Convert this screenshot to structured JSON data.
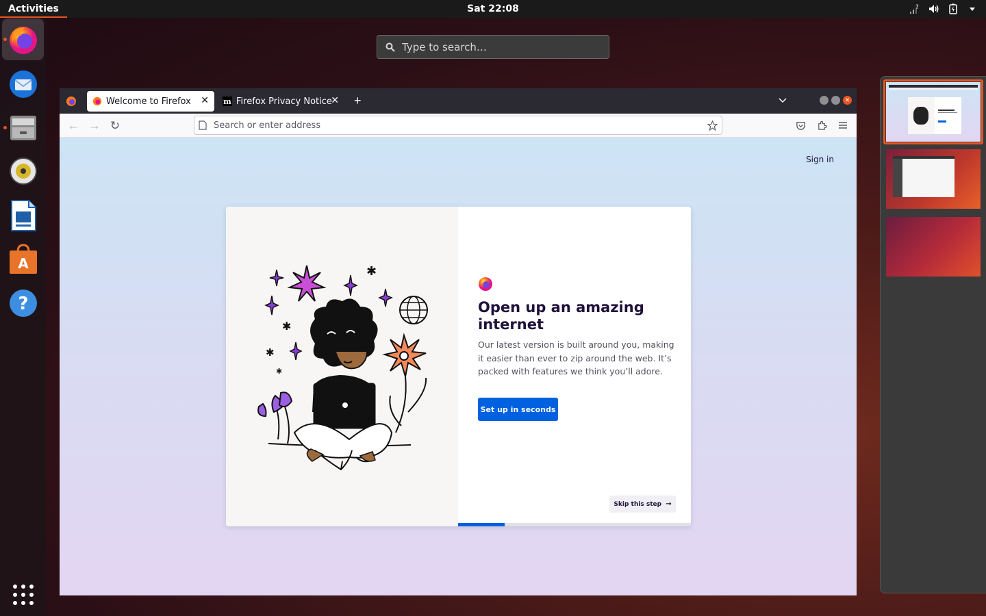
{
  "topbar": {
    "activities": "Activities",
    "clock": "Sat 22:08"
  },
  "search": {
    "placeholder": "Type to search…"
  },
  "dock": {
    "apps": [
      {
        "name": "Firefox",
        "icon": "firefox-icon",
        "running": true,
        "active": true
      },
      {
        "name": "Thunderbird",
        "icon": "thunderbird-icon",
        "running": false
      },
      {
        "name": "Files",
        "icon": "files-icon",
        "running": true
      },
      {
        "name": "Rhythmbox",
        "icon": "rhythmbox-icon",
        "running": false
      },
      {
        "name": "LibreOffice Writer",
        "icon": "writer-icon",
        "running": false
      },
      {
        "name": "Ubuntu Software",
        "icon": "software-icon",
        "running": false
      },
      {
        "name": "Help",
        "icon": "help-icon",
        "running": false
      }
    ],
    "show_apps_icon": "grid-icon"
  },
  "browser": {
    "tabs": [
      {
        "label": "Welcome to Firefox",
        "active": true
      },
      {
        "label": "Firefox Privacy Notice —",
        "active": false
      }
    ],
    "url_placeholder": "Search or enter address",
    "page": {
      "sign_in": "Sign in",
      "headline": "Open up an amazing internet",
      "body": "Our latest version is built around you, making it easier than ever to zip around the web. It’s packed with features we think you’ll adore.",
      "primary_button": "Set up in seconds",
      "skip_button": "Skip this step",
      "progress": 0.2
    }
  },
  "colors": {
    "accent": "#e95420",
    "firefox_blue": "#0061e0",
    "tabbar": "#2b2a33"
  }
}
